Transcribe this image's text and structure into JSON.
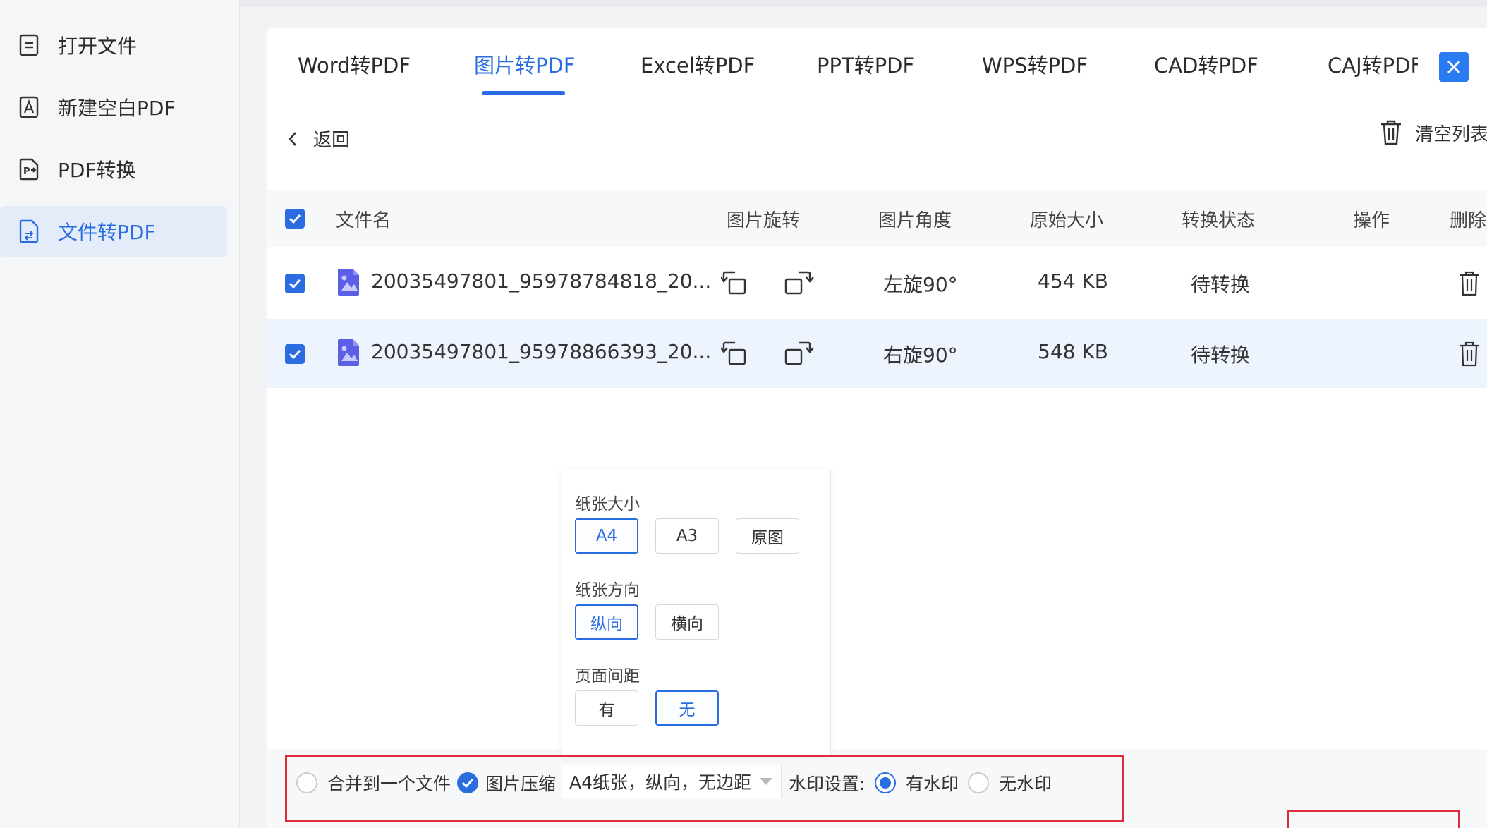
{
  "colors": {
    "accent": "#2a6de0",
    "highlight_border": "#e02b3a"
  },
  "sidebar": {
    "items": [
      {
        "label": "打开文件",
        "icon": "document-icon",
        "active": false
      },
      {
        "label": "新建空白PDF",
        "icon": "pdf-new-icon",
        "active": false
      },
      {
        "label": "PDF转换",
        "icon": "pdf-convert-icon",
        "active": false
      },
      {
        "label": "文件转PDF",
        "icon": "file-to-pdf-icon",
        "active": true
      }
    ]
  },
  "tabs": [
    {
      "label": "Word转PDF",
      "active": false
    },
    {
      "label": "图片转PDF",
      "active": true
    },
    {
      "label": "Excel转PDF",
      "active": false
    },
    {
      "label": "PPT转PDF",
      "active": false
    },
    {
      "label": "WPS转PDF",
      "active": false
    },
    {
      "label": "CAD转PDF",
      "active": false
    },
    {
      "label": "CAJ转PDF",
      "active": false
    }
  ],
  "toolbar": {
    "back_label": "返回",
    "clear_label": "清空列表"
  },
  "table": {
    "columns": [
      "文件名",
      "图片旋转",
      "图片角度",
      "原始大小",
      "转换状态",
      "操作",
      "删除"
    ],
    "rows": [
      {
        "checked": true,
        "filename": "20035497801_95978784818_20...",
        "angle": "左旋90°",
        "size": "454 KB",
        "status": "待转换"
      },
      {
        "checked": true,
        "filename": "20035497801_95978866393_20...",
        "angle": "右旋90°",
        "size": "548 KB",
        "status": "待转换"
      }
    ]
  },
  "popover": {
    "paper_size": {
      "label": "纸张大小",
      "options": [
        "A4",
        "A3",
        "原图"
      ],
      "selected": "A4"
    },
    "orientation": {
      "label": "纸张方向",
      "options": [
        "纵向",
        "横向"
      ],
      "selected": "纵向"
    },
    "margin": {
      "label": "页面间距",
      "options": [
        "有",
        "无"
      ],
      "selected": "无"
    }
  },
  "bottom": {
    "merge_label": "合并到一个文件",
    "compress_label": "图片压缩",
    "page_setting": "A4纸张，纵向，无边距",
    "watermark_label": "水印设置:",
    "watermark_on": "有水印",
    "watermark_off": "无水印"
  }
}
